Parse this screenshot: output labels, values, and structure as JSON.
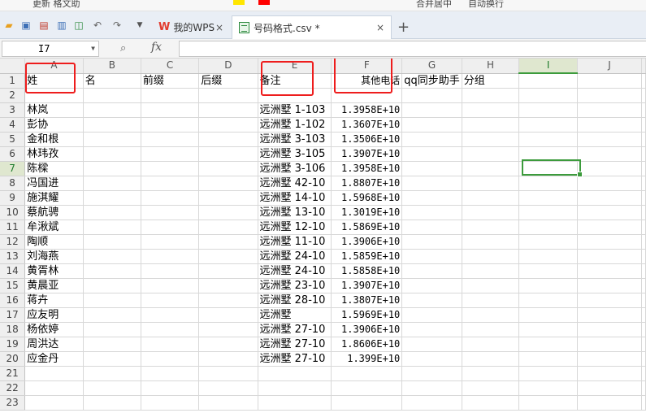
{
  "ribbon": {
    "fragments": [
      "更新 格文助",
      "合并居中",
      "自动换行"
    ]
  },
  "toolbar": {
    "icons": [
      "open-folder-icon",
      "save-icon",
      "export-pdf-icon",
      "print-icon",
      "print-preview-icon",
      "undo-icon",
      "redo-icon",
      "more-icon"
    ]
  },
  "tabs": [
    {
      "label": "我的WPS",
      "close": "×"
    },
    {
      "label": "号码格式.csv *",
      "close": "×"
    }
  ],
  "add_tab": "+",
  "formula_bar": {
    "cell_ref": "I7",
    "fx": "fx",
    "zoom_icon": "⌕",
    "value": ""
  },
  "columns": [
    "A",
    "B",
    "C",
    "D",
    "E",
    "F",
    "G",
    "H",
    "I",
    "J"
  ],
  "selected_column": "I",
  "selected_row": "7",
  "rows": [
    {
      "n": "1",
      "cells": [
        "姓",
        "名",
        "前缀",
        "后缀",
        "备注",
        "其他电话",
        "qq同步助手",
        "分组",
        "",
        ""
      ]
    },
    {
      "n": "2",
      "cells": [
        "",
        "",
        "",
        "",
        "",
        "",
        "",
        "",
        "",
        ""
      ]
    },
    {
      "n": "3",
      "cells": [
        "林岚",
        "",
        "",
        "",
        "远洲墅 1-103",
        "1.3958E+10",
        "",
        "",
        "",
        ""
      ]
    },
    {
      "n": "4",
      "cells": [
        "彭协",
        "",
        "",
        "",
        "远洲墅 1-102",
        "1.3607E+10",
        "",
        "",
        "",
        ""
      ]
    },
    {
      "n": "5",
      "cells": [
        "金和根",
        "",
        "",
        "",
        "远洲墅 3-103",
        "1.3506E+10",
        "",
        "",
        "",
        ""
      ]
    },
    {
      "n": "6",
      "cells": [
        "林玮孜",
        "",
        "",
        "",
        "远洲墅 3-105",
        "1.3907E+10",
        "",
        "",
        "",
        ""
      ]
    },
    {
      "n": "7",
      "cells": [
        "陈樑",
        "",
        "",
        "",
        "远洲墅 3-106",
        "1.3958E+10",
        "",
        "",
        "",
        ""
      ]
    },
    {
      "n": "8",
      "cells": [
        "冯国进",
        "",
        "",
        "",
        "远洲墅 42-10",
        "1.8807E+10",
        "",
        "",
        "",
        ""
      ]
    },
    {
      "n": "9",
      "cells": [
        "施淇耀",
        "",
        "",
        "",
        "远洲墅 14-10",
        "1.5968E+10",
        "",
        "",
        "",
        ""
      ]
    },
    {
      "n": "10",
      "cells": [
        "蔡航骋",
        "",
        "",
        "",
        "远洲墅 13-10",
        "1.3019E+10",
        "",
        "",
        "",
        ""
      ]
    },
    {
      "n": "11",
      "cells": [
        "牟湫斌",
        "",
        "",
        "",
        "远洲墅 12-10",
        "1.5869E+10",
        "",
        "",
        "",
        ""
      ]
    },
    {
      "n": "12",
      "cells": [
        "陶顺",
        "",
        "",
        "",
        "远洲墅 11-10",
        "1.3906E+10",
        "",
        "",
        "",
        ""
      ]
    },
    {
      "n": "13",
      "cells": [
        "刘海燕",
        "",
        "",
        "",
        "远洲墅 24-10",
        "1.5859E+10",
        "",
        "",
        "",
        ""
      ]
    },
    {
      "n": "14",
      "cells": [
        "黄胥林",
        "",
        "",
        "",
        "远洲墅 24-10",
        "1.5858E+10",
        "",
        "",
        "",
        ""
      ]
    },
    {
      "n": "15",
      "cells": [
        "黄晨亚",
        "",
        "",
        "",
        "远洲墅 23-10",
        "1.3907E+10",
        "",
        "",
        "",
        ""
      ]
    },
    {
      "n": "16",
      "cells": [
        "蒋卉",
        "",
        "",
        "",
        "远洲墅 28-10",
        "1.3807E+10",
        "",
        "",
        "",
        ""
      ]
    },
    {
      "n": "17",
      "cells": [
        "应友明",
        "",
        "",
        "",
        " 远洲墅",
        "1.5969E+10",
        "",
        "",
        "",
        ""
      ]
    },
    {
      "n": "18",
      "cells": [
        "杨依婷",
        "",
        "",
        "",
        "远洲墅 27-10",
        "1.3906E+10",
        "",
        "",
        "",
        ""
      ]
    },
    {
      "n": "19",
      "cells": [
        "周洪达",
        "",
        "",
        "",
        "远洲墅 27-10",
        "1.8606E+10",
        "",
        "",
        "",
        ""
      ]
    },
    {
      "n": "20",
      "cells": [
        "应金丹",
        "",
        "",
        "",
        "远洲墅 27-10",
        "1.399E+10",
        "",
        "",
        "",
        ""
      ]
    },
    {
      "n": "21",
      "cells": [
        "",
        "",
        "",
        "",
        "",
        "",
        "",
        "",
        "",
        ""
      ]
    },
    {
      "n": "22",
      "cells": [
        "",
        "",
        "",
        "",
        "",
        "",
        "",
        "",
        "",
        ""
      ]
    },
    {
      "n": "23",
      "cells": [
        "",
        "",
        "",
        "",
        "",
        "",
        "",
        "",
        "",
        ""
      ]
    }
  ],
  "colors": {
    "selection": "#3c9b3c",
    "annotation": "#ee1d1d",
    "wps_brand": "#e23b2e"
  }
}
